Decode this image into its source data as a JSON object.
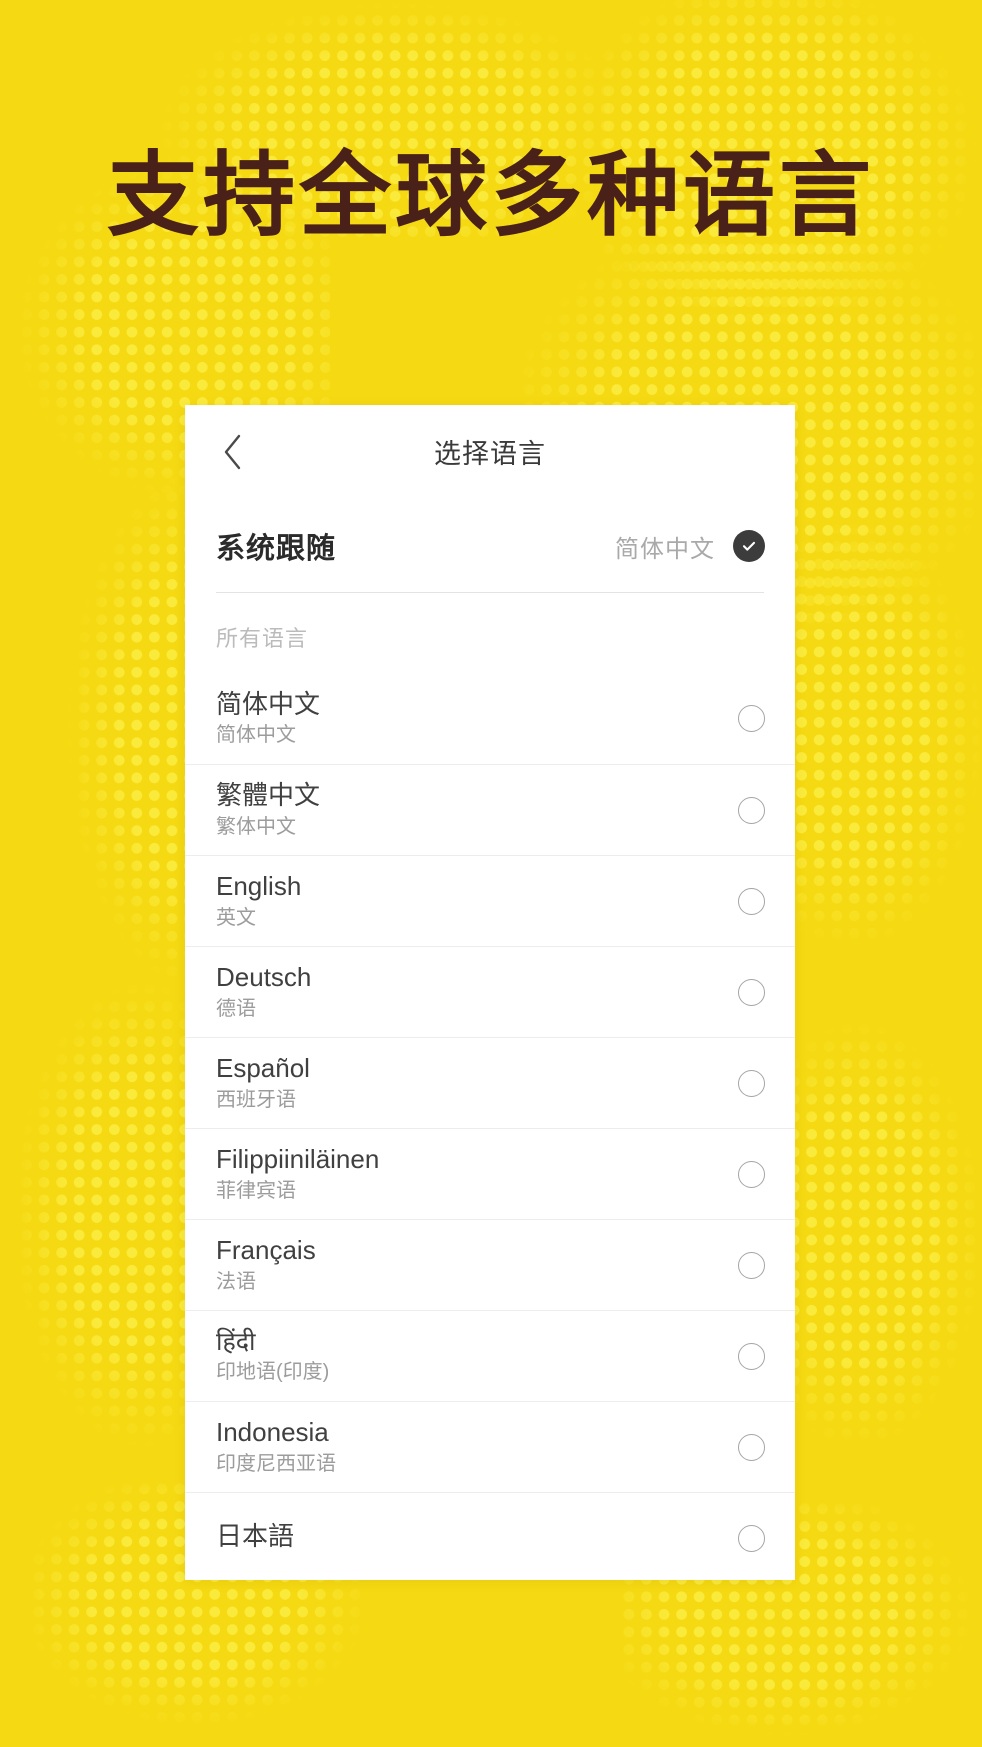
{
  "page": {
    "headline": "支持全球多种语言",
    "background_color": "#F5D912",
    "dot_color": "#FBEB3E",
    "headline_color": "#4A2118"
  },
  "screen": {
    "nav": {
      "back_icon": "chevron-left-icon",
      "title": "选择语言"
    },
    "follow_system": {
      "label": "系统跟随",
      "value": "简体中文",
      "checked": true,
      "check_icon": "check-circle-filled-icon"
    },
    "section_header": "所有语言",
    "languages": [
      {
        "native": "简体中文",
        "sub": "简体中文",
        "selected": false
      },
      {
        "native": "繁體中文",
        "sub": "繁体中文",
        "selected": false
      },
      {
        "native": "English",
        "sub": "英文",
        "selected": false
      },
      {
        "native": "Deutsch",
        "sub": "德语",
        "selected": false
      },
      {
        "native": "Español",
        "sub": "西班牙语",
        "selected": false
      },
      {
        "native": "Filippiiniläinen",
        "sub": "菲律宾语",
        "selected": false
      },
      {
        "native": "Français",
        "sub": "法语",
        "selected": false
      },
      {
        "native": "हिंदी",
        "sub": "印地语(印度)",
        "selected": false
      },
      {
        "native": "Indonesia",
        "sub": "印度尼西亚语",
        "selected": false
      },
      {
        "native": "日本語",
        "sub": "",
        "selected": false
      }
    ]
  }
}
